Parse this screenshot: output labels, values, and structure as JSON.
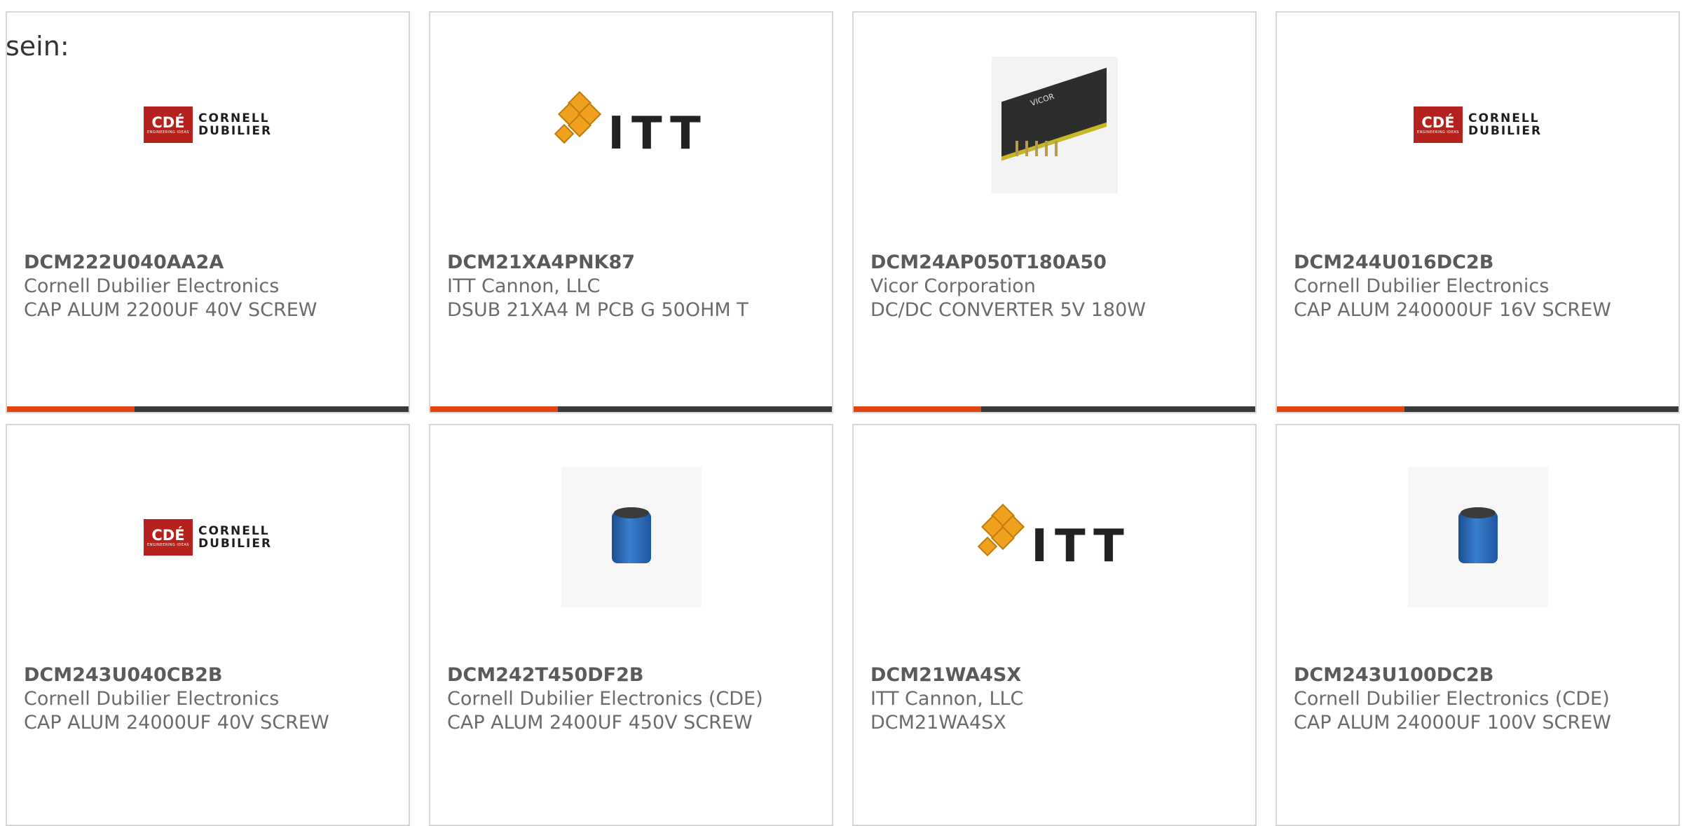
{
  "intro_text": "sein:",
  "colors": {
    "accent": "#e24513",
    "bar_dark": "#3a3a3a",
    "border": "#d8d8d8"
  },
  "products": [
    {
      "part_number": "DCM222U040AA2A",
      "manufacturer": "Cornell Dubilier Electronics",
      "description": "CAP ALUM 2200UF 40V SCREW",
      "image": "cde-logo",
      "logo_text": "CDE CORNELL DUBILIER"
    },
    {
      "part_number": "DCM21XA4PNK87",
      "manufacturer": "ITT Cannon, LLC",
      "description": "DSUB 21XA4 M PCB G 50OHM T",
      "image": "itt-logo",
      "logo_text": "ITT"
    },
    {
      "part_number": "DCM24AP050T180A50",
      "manufacturer": "Vicor Corporation",
      "description": "DC/DC CONVERTER 5V 180W",
      "image": "converter-photo",
      "logo_text": "VICOR"
    },
    {
      "part_number": "DCM244U016DC2B",
      "manufacturer": "Cornell Dubilier Electronics",
      "description": "CAP ALUM 240000UF 16V SCREW",
      "image": "cde-logo",
      "logo_text": "CDE CORNELL DUBILIER"
    },
    {
      "part_number": "DCM243U040CB2B",
      "manufacturer": "Cornell Dubilier Electronics",
      "description": "CAP ALUM 24000UF 40V SCREW",
      "image": "cde-logo",
      "logo_text": "CDE CORNELL DUBILIER"
    },
    {
      "part_number": "DCM242T450DF2B",
      "manufacturer": "Cornell Dubilier Electronics (CDE)",
      "description": "CAP ALUM 2400UF 450V SCREW",
      "image": "capacitor-photo"
    },
    {
      "part_number": "DCM21WA4SX",
      "manufacturer": "ITT Cannon, LLC",
      "description": "DCM21WA4SX",
      "image": "itt-logo",
      "logo_text": "ITT"
    },
    {
      "part_number": "DCM243U100DC2B",
      "manufacturer": "Cornell Dubilier Electronics (CDE)",
      "description": "CAP ALUM 24000UF 100V SCREW",
      "image": "capacitor-photo"
    }
  ]
}
